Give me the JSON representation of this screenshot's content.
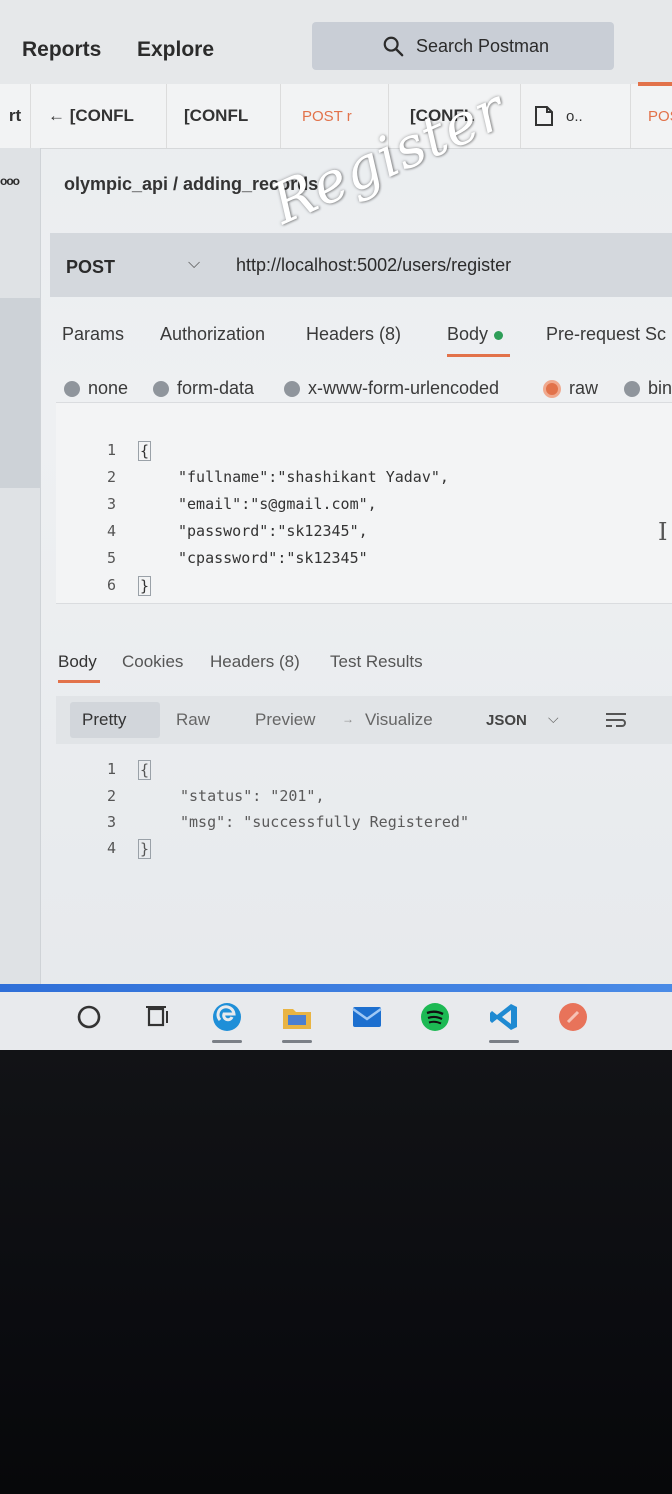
{
  "header": {
    "nav_reports": "Reports",
    "nav_explore": "Explore",
    "search_label": "Search Postman"
  },
  "tabs": [
    {
      "label": "rt"
    },
    {
      "label": "← [CONFL"
    },
    {
      "label": "[CONFL"
    },
    {
      "label": "POST r"
    },
    {
      "label": "[CONFL"
    },
    {
      "label": "o.."
    },
    {
      "label": "POS"
    }
  ],
  "sidebar": {
    "dots": "ooo"
  },
  "breadcrumb": "olympic_api / adding_records",
  "request": {
    "method": "POST",
    "url": "http://localhost:5002/users/register",
    "tabs": [
      "Params",
      "Authorization",
      "Headers (8)",
      "Body",
      "Pre-request Sc"
    ],
    "active_tab": "Body",
    "body_modes": [
      "none",
      "form-data",
      "x-www-form-urlencoded",
      "raw",
      "bin"
    ],
    "selected_mode": "raw",
    "body_lines": [
      {
        "n": "1",
        "text": "{"
      },
      {
        "n": "2",
        "text": "\"fullname\":\"shashikant Yadav\","
      },
      {
        "n": "3",
        "text": "\"email\":\"s@gmail.com\","
      },
      {
        "n": "4",
        "text": "\"password\":\"sk12345\","
      },
      {
        "n": "5",
        "text": "\"cpassword\":\"sk12345\""
      },
      {
        "n": "6",
        "text": "}"
      }
    ]
  },
  "response": {
    "tabs": [
      "Body",
      "Cookies",
      "Headers (8)",
      "Test Results"
    ],
    "active_tab": "Body",
    "views": [
      "Pretty",
      "Raw",
      "Preview",
      "Visualize"
    ],
    "active_view": "Pretty",
    "format": "JSON",
    "lines": [
      {
        "n": "1",
        "text": "{"
      },
      {
        "n": "2",
        "text": "\"status\": \"201\","
      },
      {
        "n": "3",
        "text": "\"msg\": \"successfully Registered\""
      },
      {
        "n": "4",
        "text": "}"
      }
    ]
  },
  "taskbar": {
    "icons": [
      "search-circle-icon",
      "task-view-icon",
      "edge-icon",
      "file-explorer-icon",
      "mail-icon",
      "spotify-icon",
      "vscode-icon",
      "postman-icon"
    ]
  },
  "watermark": "Register",
  "colors": {
    "accent": "#e2724a",
    "taskbar_line": "#2f6fd8",
    "success_dot": "#2e9e58"
  }
}
